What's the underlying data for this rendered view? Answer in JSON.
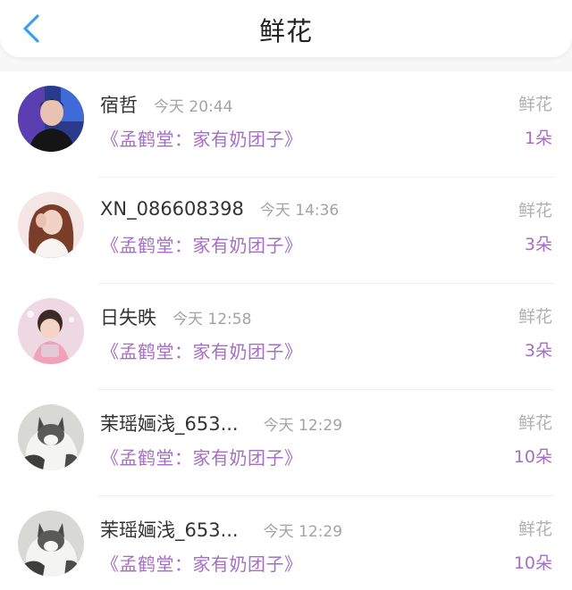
{
  "header": {
    "title": "鲜花",
    "back_icon": "chevron-left-icon",
    "accent_color": "#3aa0f0"
  },
  "records": [
    {
      "username": "宿哲",
      "time": "今天 20:44",
      "book": "《孟鹤堂：家有奶团子》",
      "gift_label": "鲜花",
      "count": "1朵"
    },
    {
      "username": "XN_086608398",
      "time": "今天 14:36",
      "book": "《孟鹤堂：家有奶团子》",
      "gift_label": "鲜花",
      "count": "3朵"
    },
    {
      "username": "日失昳",
      "time": "今天 12:58",
      "book": "《孟鹤堂：家有奶团子》",
      "gift_label": "鲜花",
      "count": "3朵"
    },
    {
      "username": "茉瑶婳浅_653...",
      "time": "今天 12:29",
      "book": "《孟鹤堂：家有奶团子》",
      "gift_label": "鲜花",
      "count": "10朵"
    },
    {
      "username": "茉瑶婳浅_653...",
      "time": "今天 12:29",
      "book": "《孟鹤堂：家有奶团子》",
      "gift_label": "鲜花",
      "count": "10朵"
    }
  ],
  "colors": {
    "book_title": "#a56fc4",
    "secondary_text": "#a3a3a3"
  }
}
